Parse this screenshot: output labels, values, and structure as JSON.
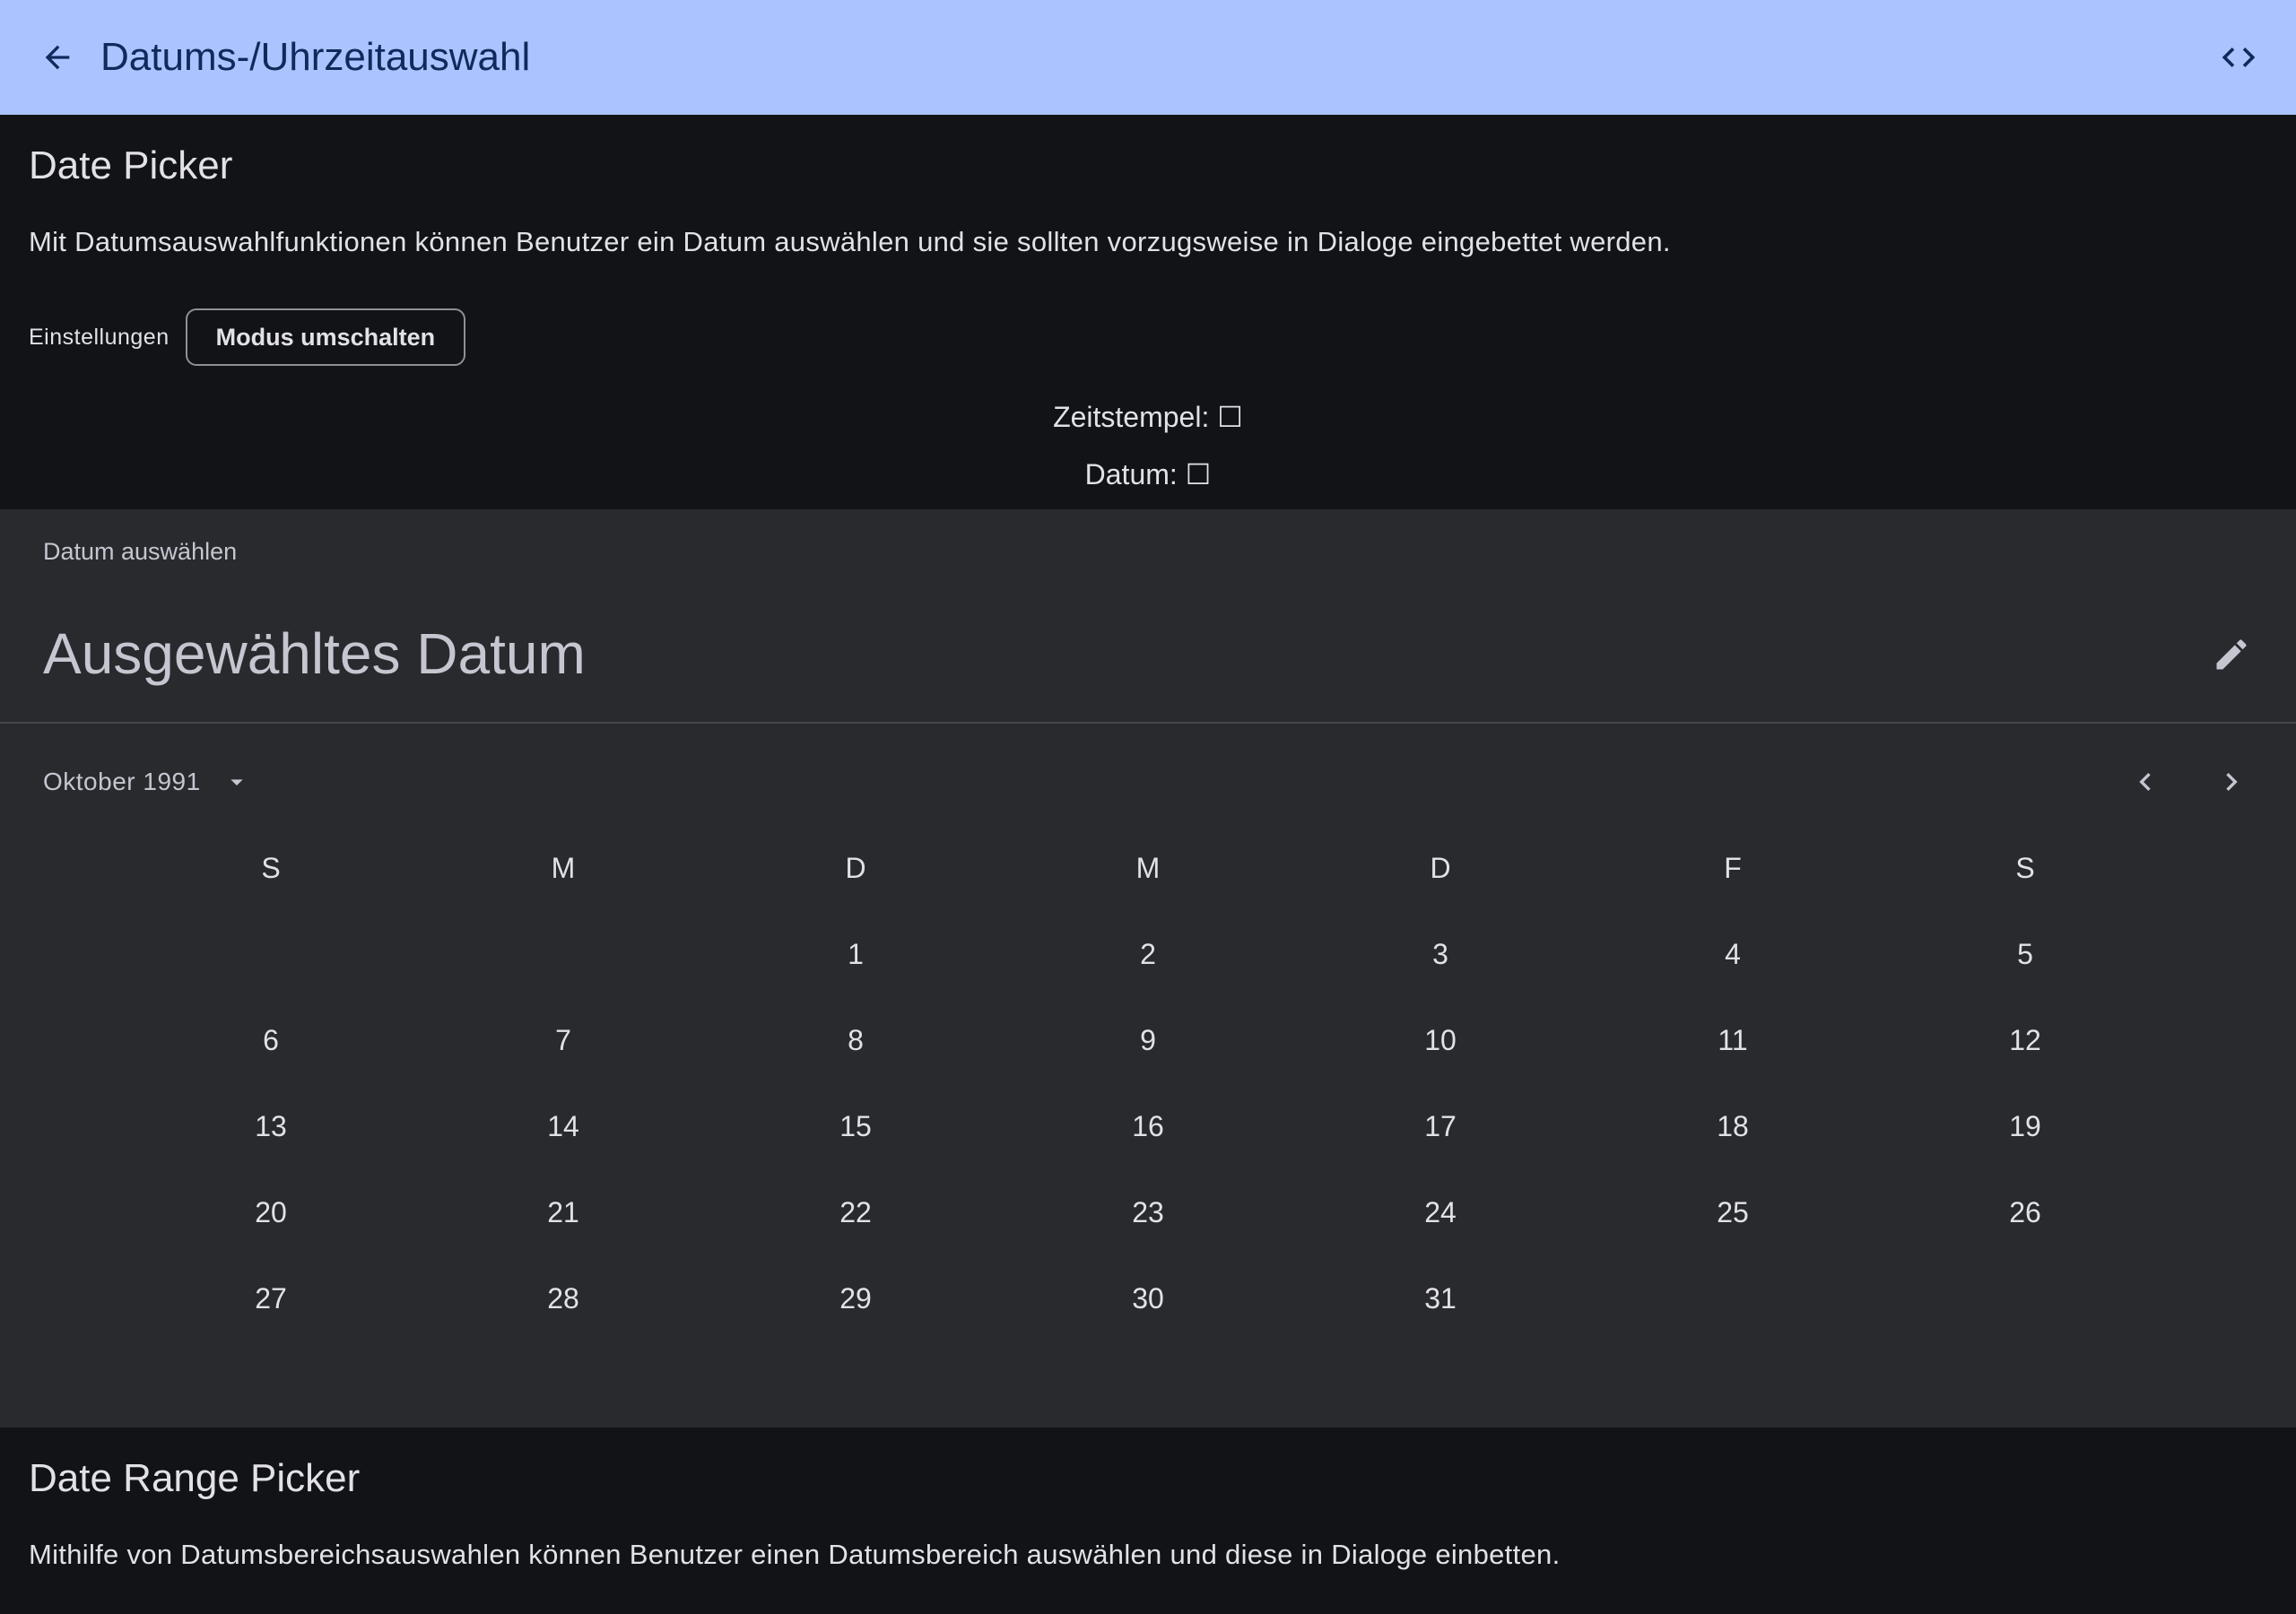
{
  "topbar": {
    "title": "Datums-/Uhrzeitauswahl",
    "back_icon": "arrow-back-icon",
    "code_icon": "code-icon",
    "background": "#abc4ff"
  },
  "date_picker_section": {
    "title": "Date Picker",
    "description": "Mit Datumsauswahlfunktionen können Benutzer ein Datum auswählen und sie sollten vorzugsweise in Dialoge eingebettet werden.",
    "settings_label": "Einstellungen",
    "mode_button": "Modus umschalten",
    "timestamp_line": "Zeitstempel: ☐",
    "date_line": "Datum: ☐"
  },
  "picker": {
    "headline_small": "Datum auswählen",
    "headline": "Ausgewähltes Datum",
    "edit_icon": "pencil-icon",
    "month_label": "Oktober 1991",
    "month_dropdown_icon": "arrow-drop-down-icon",
    "prev_icon": "chevron-left-icon",
    "next_icon": "chevron-right-icon",
    "weekdays": [
      "S",
      "M",
      "D",
      "M",
      "D",
      "F",
      "S"
    ],
    "weeks": [
      [
        "",
        "",
        "1",
        "2",
        "3",
        "4",
        "5"
      ],
      [
        "6",
        "7",
        "8",
        "9",
        "10",
        "11",
        "12"
      ],
      [
        "13",
        "14",
        "15",
        "16",
        "17",
        "18",
        "19"
      ],
      [
        "20",
        "21",
        "22",
        "23",
        "24",
        "25",
        "26"
      ],
      [
        "27",
        "28",
        "29",
        "30",
        "31",
        "",
        ""
      ]
    ]
  },
  "date_range_section": {
    "title": "Date Range Picker",
    "description": "Mithilfe von Datumsbereichsauswahlen können Benutzer einen Datumsbereich auswählen und diese in Dialoge einbetten."
  }
}
